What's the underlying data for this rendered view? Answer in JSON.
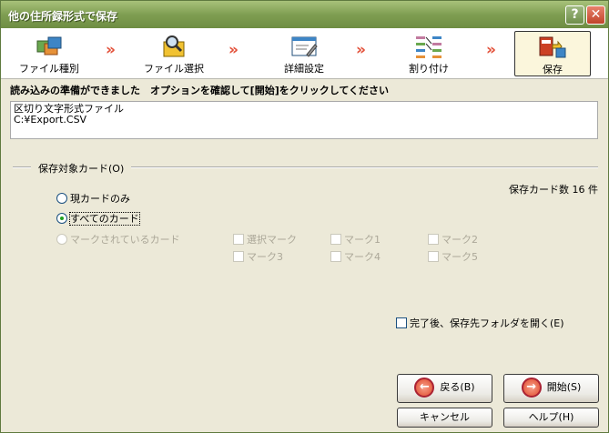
{
  "window": {
    "title": "他の住所録形式で保存"
  },
  "steps": [
    {
      "label": "ファイル種別",
      "icon": "folders-icon"
    },
    {
      "label": "ファイル選択",
      "icon": "folder-search-icon"
    },
    {
      "label": "詳細設定",
      "icon": "settings-window-icon"
    },
    {
      "label": "割り付け",
      "icon": "mapping-icon"
    },
    {
      "label": "保存",
      "icon": "save-book-icon"
    }
  ],
  "arrow": "»",
  "instruction": "読み込みの準備ができました　オプションを確認して[開始]をクリックしてください",
  "info": {
    "line1": "区切り文字形式ファイル",
    "line2": "C:¥Export.CSV"
  },
  "group_title": "保存対象カード(O)",
  "card_count": "保存カード数 16 件",
  "radios": [
    {
      "label": "現カードのみ",
      "checked": false,
      "enabled": true
    },
    {
      "label": "すべてのカード",
      "checked": true,
      "enabled": true
    },
    {
      "label": "マークされているカード",
      "checked": false,
      "enabled": false
    }
  ],
  "marks": [
    "選択マーク",
    "マーク1",
    "マーク2",
    "マーク3",
    "マーク4",
    "マーク5"
  ],
  "open_folder": {
    "label": "完了後、保存先フォルダを開く(E)",
    "checked": false
  },
  "buttons": {
    "back": "戻る(B)",
    "start": "開始(S)",
    "cancel": "キャンセル",
    "help": "ヘルプ(H)"
  },
  "colors": {
    "titlebar": "#7f9e52",
    "accent_arrow": "#e3513a",
    "radio_dot": "#21a121"
  }
}
